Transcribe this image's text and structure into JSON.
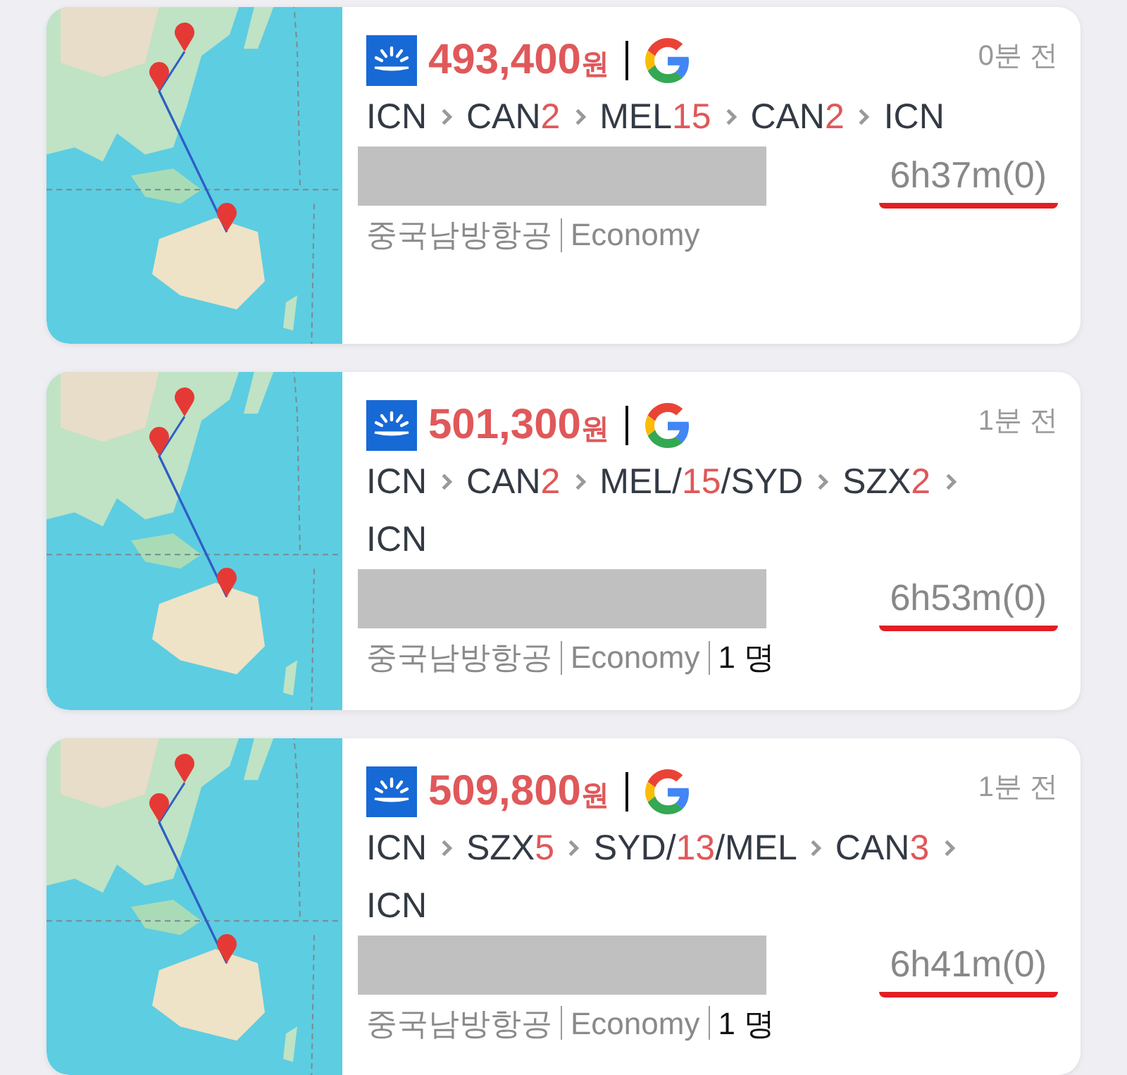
{
  "results": [
    {
      "price": "493,400",
      "currency": "원",
      "time_ago": "0분 전",
      "route": [
        {
          "kind": "code",
          "text": "ICN"
        },
        {
          "kind": "chevron"
        },
        {
          "kind": "code",
          "text": "CAN"
        },
        {
          "kind": "stay",
          "text": "2"
        },
        {
          "kind": "chevron"
        },
        {
          "kind": "code",
          "text": "MEL"
        },
        {
          "kind": "stay",
          "text": "15"
        },
        {
          "kind": "chevron"
        },
        {
          "kind": "code",
          "text": "CAN"
        },
        {
          "kind": "stay",
          "text": "2"
        },
        {
          "kind": "chevron"
        },
        {
          "kind": "code",
          "text": "ICN"
        }
      ],
      "duration": "6h37m(0)",
      "meta": [
        {
          "kind": "info",
          "text": "중국남방항공"
        },
        {
          "kind": "info",
          "text": "Economy"
        }
      ]
    },
    {
      "price": "501,300",
      "currency": "원",
      "time_ago": "1분 전",
      "route": [
        {
          "kind": "code",
          "text": "ICN"
        },
        {
          "kind": "chevron"
        },
        {
          "kind": "code",
          "text": "CAN"
        },
        {
          "kind": "stay",
          "text": "2"
        },
        {
          "kind": "chevron"
        },
        {
          "kind": "code",
          "text": "MEL"
        },
        {
          "kind": "slash",
          "text": "/"
        },
        {
          "kind": "stay",
          "text": "15"
        },
        {
          "kind": "slash",
          "text": "/"
        },
        {
          "kind": "code",
          "text": "SYD"
        },
        {
          "kind": "chevron"
        },
        {
          "kind": "code",
          "text": "SZX"
        },
        {
          "kind": "stay",
          "text": "2"
        },
        {
          "kind": "chevron"
        },
        {
          "kind": "code",
          "text": "ICN"
        }
      ],
      "duration": "6h53m(0)",
      "meta": [
        {
          "kind": "info",
          "text": "중국남방항공"
        },
        {
          "kind": "info",
          "text": "Economy"
        },
        {
          "kind": "count",
          "text": "1 명"
        }
      ]
    },
    {
      "price": "509,800",
      "currency": "원",
      "time_ago": "1분 전",
      "route": [
        {
          "kind": "code",
          "text": "ICN"
        },
        {
          "kind": "chevron"
        },
        {
          "kind": "code",
          "text": "SZX"
        },
        {
          "kind": "stay",
          "text": "5"
        },
        {
          "kind": "chevron"
        },
        {
          "kind": "code",
          "text": "SYD"
        },
        {
          "kind": "slash",
          "text": "/"
        },
        {
          "kind": "stay",
          "text": "13"
        },
        {
          "kind": "slash",
          "text": "/"
        },
        {
          "kind": "code",
          "text": "MEL"
        },
        {
          "kind": "chevron"
        },
        {
          "kind": "code",
          "text": "CAN"
        },
        {
          "kind": "stay",
          "text": "3"
        },
        {
          "kind": "chevron"
        },
        {
          "kind": "code",
          "text": "ICN"
        }
      ],
      "duration": "6h41m(0)",
      "meta": [
        {
          "kind": "info",
          "text": "중국남방항공"
        },
        {
          "kind": "info",
          "text": "Economy"
        },
        {
          "kind": "count",
          "text": "1 명"
        }
      ]
    }
  ]
}
